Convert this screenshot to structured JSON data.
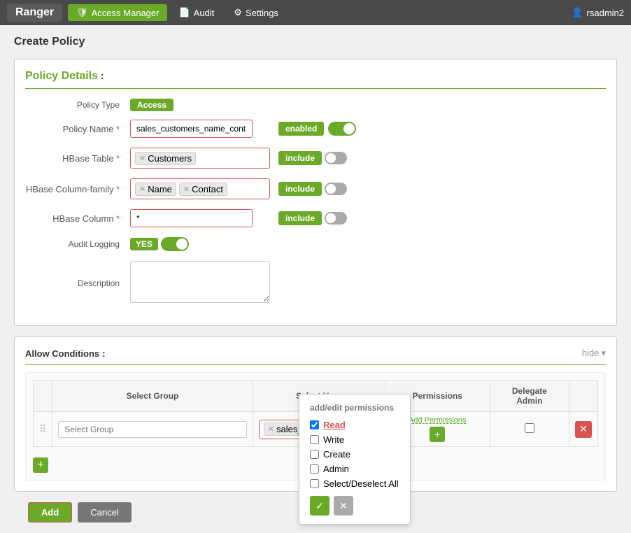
{
  "nav": {
    "brand": "Ranger",
    "items": [
      {
        "label": "Access Manager",
        "icon": "shield",
        "active": true
      },
      {
        "label": "Audit",
        "icon": "doc"
      },
      {
        "label": "Settings",
        "icon": "gear"
      }
    ],
    "user": "rsadmin2"
  },
  "page": {
    "title": "Create Policy"
  },
  "policy_details": {
    "section_title": "Policy Details",
    "policy_type_label": "Policy Type",
    "policy_type_badge": "Access",
    "policy_name_label": "Policy Name",
    "policy_name_req": "*",
    "policy_name_value": "sales_customers_name_contact",
    "enabled_toggle": "enabled",
    "hbase_table_label": "HBase Table",
    "hbase_table_req": "*",
    "hbase_table_tag": "Customers",
    "include1": "include",
    "hbase_cf_label": "HBase Column-family",
    "hbase_cf_req": "*",
    "hbase_cf_tag1": "Name",
    "hbase_cf_tag2": "Contact",
    "include2": "include",
    "hbase_col_label": "HBase Column",
    "hbase_col_req": "*",
    "hbase_col_value": "*",
    "include3": "include",
    "audit_logging_label": "Audit Logging",
    "yes_label": "YES",
    "description_label": "Description",
    "description_placeholder": ""
  },
  "allow_conditions": {
    "section_title": "Allow Conditions",
    "hide_label": "hide",
    "hide_arrow": "▾",
    "col_select_group": "Select Group",
    "col_select_user": "Select User",
    "col_permissions": "Permissions",
    "col_delegate_admin": "Delegate Admin",
    "col_action": "",
    "row": {
      "group_placeholder": "Select Group",
      "user_tag": "sales_user1",
      "add_perms_label": "Add Permissions",
      "add_perms_btn": "+"
    },
    "add_row_btn": "+"
  },
  "permissions_popup": {
    "title": "add/edit permissions",
    "checks": [
      {
        "label": "Read",
        "checked": true
      },
      {
        "label": "Write",
        "checked": false
      },
      {
        "label": "Create",
        "checked": false
      },
      {
        "label": "Admin",
        "checked": false
      },
      {
        "label": "Select/Deselect All",
        "checked": false
      }
    ],
    "ok_icon": "✓",
    "cancel_icon": "✕"
  },
  "footer": {
    "add_label": "Add",
    "cancel_label": "Cancel"
  }
}
